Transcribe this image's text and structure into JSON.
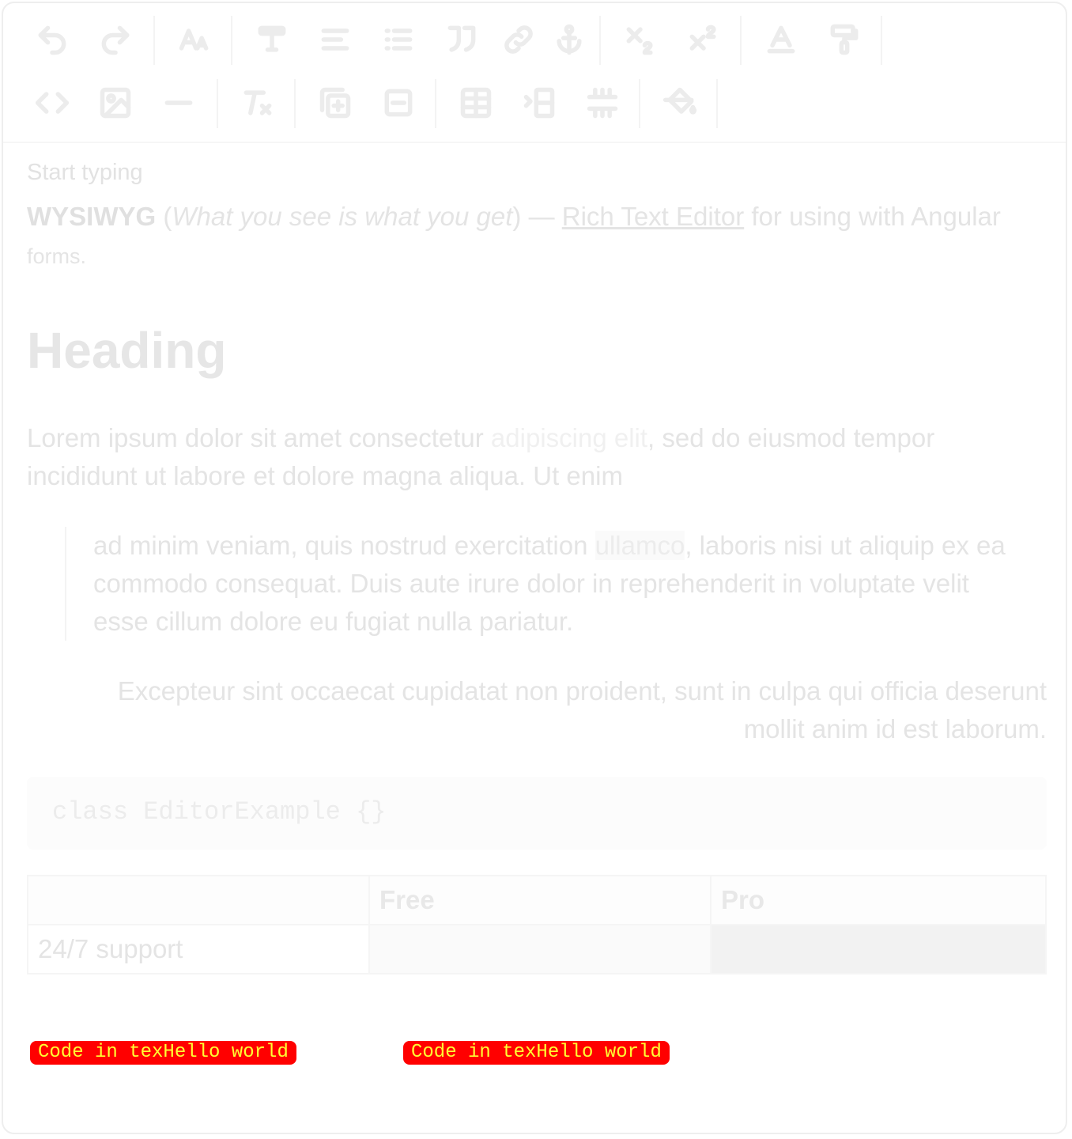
{
  "toolbar": {
    "row1": [
      "undo-icon",
      "redo-icon",
      "font-size-icon",
      "text-style-icon",
      "align-icon",
      "list-icon",
      "quote-icon",
      "link-icon",
      "anchor-icon",
      "subscript-icon",
      "superscript-icon",
      "text-color-icon",
      "format-painter-icon"
    ],
    "row2": [
      "code-icon",
      "image-icon",
      "horizontal-rule-icon",
      "clear-format-icon",
      "insert-block-icon",
      "remove-block-icon",
      "table-icon",
      "row-insert-icon",
      "cell-merge-icon",
      "fill-color-icon"
    ]
  },
  "editor": {
    "placeholder": "Start typing",
    "intro": {
      "bold": "WYSIWYG",
      "open_paren": " (",
      "italic": "What you see is what you get",
      "close_dash": ") — ",
      "link": "Rich Text Editor",
      "rest": " for using with Angular",
      "rest2": "forms."
    },
    "heading": "Heading",
    "para": {
      "a": "Lorem ipsum dolor sit amet consectetur ",
      "highlight": "adipiscing elit",
      "b": ", sed do eiusmod tempor incididunt ut labore et dolore magna aliqua. Ut enim"
    },
    "quote": {
      "a": "ad minim veniam, quis nostrud exercitation ",
      "mark": "ullamco",
      "b": ", laboris nisi ut aliquip ex ea commodo consequat. Duis aute irure dolor in reprehenderit in voluptate velit esse cillum dolore eu fugiat nulla pariatur."
    },
    "right_para": "Excepteur sint occaecat cupidatat non proident, sunt in culpa qui officia deserunt mollit anim id est laborum.",
    "code": "class EditorExample {}",
    "table": {
      "headers": [
        "",
        "Free",
        "Pro"
      ],
      "row": [
        "24/7 support",
        "",
        ""
      ]
    },
    "chips": [
      "Code in texHello world",
      "Code in texHello world"
    ]
  },
  "colors": {
    "chip_bg": "#ff0000",
    "chip_text": "#ffff33"
  }
}
